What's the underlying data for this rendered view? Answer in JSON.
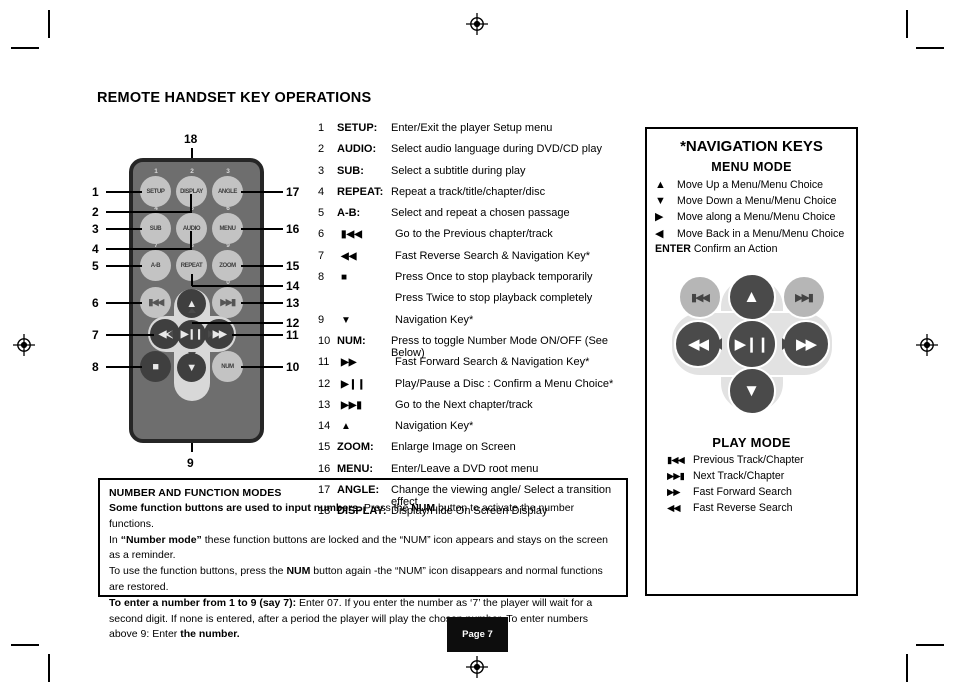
{
  "page_title": "REMOTE HANDSET KEY OPERATIONS",
  "footer": {
    "page_label": "Page 7"
  },
  "colors": {
    "remote_body": "#6e6e6e",
    "remote_border": "#262626",
    "button_light": "#c3c3c3",
    "button_dark": "#3f3f3f",
    "dpad_pad": "#e2e2e2",
    "ink": "#000000"
  },
  "remote": {
    "buttons": [
      {
        "label": "SETUP",
        "number": "1"
      },
      {
        "label": "DISPLAY",
        "number": "2"
      },
      {
        "label": "ANGLE",
        "number": "3"
      },
      {
        "label": "SUB",
        "number": "4"
      },
      {
        "label": "AUDIO",
        "number": "5"
      },
      {
        "label": "MENU",
        "number": "6"
      },
      {
        "label": "A-B",
        "number": "7"
      },
      {
        "label": "REPEAT",
        "number": "8"
      },
      {
        "label": "ZOOM",
        "number": "9"
      },
      {
        "label": "▮◀◀",
        "number": ""
      },
      {
        "label": "▶▶▮",
        "number": "0"
      },
      {
        "label": "NUM",
        "number": ""
      }
    ],
    "callouts_left": [
      "1",
      "2",
      "3",
      "4",
      "5",
      "6",
      "7",
      "8"
    ],
    "callouts_right": [
      "17",
      "16",
      "15",
      "14",
      "13",
      "12",
      "11",
      "10"
    ],
    "callout_top": "18",
    "callout_bottom": "9"
  },
  "key_list": [
    {
      "idx": "1",
      "name": "SETUP:",
      "desc": "Enter/Exit the player Setup menu",
      "glyph": false
    },
    {
      "idx": "2",
      "name": "AUDIO:",
      "desc": "Select audio language during DVD/CD play",
      "glyph": false
    },
    {
      "idx": "3",
      "name": "SUB:",
      "desc": "Select a subtitle during play",
      "glyph": false
    },
    {
      "idx": "4",
      "name": "REPEAT:",
      "desc": "Repeat a track/title/chapter/disc",
      "glyph": false
    },
    {
      "idx": "5",
      "name": "A-B:",
      "desc": "Select and repeat a chosen passage",
      "glyph": false
    },
    {
      "idx": "6",
      "name": "▮◀◀",
      "desc": "Go to the Previous chapter/track",
      "glyph": true
    },
    {
      "idx": "7",
      "name": "◀◀",
      "desc": "Fast Reverse Search & Navigation Key*",
      "glyph": true
    },
    {
      "idx": "8",
      "name": "■",
      "desc": "Press Once to stop playback temporarily",
      "glyph": true
    },
    {
      "idx": "",
      "name": "",
      "desc": "Press Twice to stop playback completely",
      "glyph": true
    },
    {
      "idx": "9",
      "name": "▼",
      "desc": "Navigation Key*",
      "glyph": true
    },
    {
      "idx": "10",
      "name": "NUM:",
      "desc": "Press to toggle Number Mode ON/OFF (See Below)",
      "glyph": false
    },
    {
      "idx": "11",
      "name": "▶▶",
      "desc": "Fast Forward Search & Navigation Key*",
      "glyph": true
    },
    {
      "idx": "12",
      "name": "▶❙❙",
      "desc": "Play/Pause a Disc : Confirm a Menu Choice*",
      "glyph": true
    },
    {
      "idx": "13",
      "name": "▶▶▮",
      "desc": "Go to the Next chapter/track",
      "glyph": true
    },
    {
      "idx": "14",
      "name": "▲",
      "desc": "Navigation Key*",
      "glyph": true
    },
    {
      "idx": "15",
      "name": "ZOOM:",
      "desc": "Enlarge Image on Screen",
      "glyph": false
    },
    {
      "idx": "16",
      "name": "MENU:",
      "desc": "Enter/Leave a DVD root menu",
      "glyph": false
    },
    {
      "idx": "17",
      "name": "ANGLE:",
      "desc": "Change the viewing angle/ Select a transition effect",
      "glyph": false
    },
    {
      "idx": "18",
      "name": "DISPLAY:",
      "desc": "Display/Hide On Screen Display",
      "glyph": false
    }
  ],
  "number_modes": {
    "heading": "NUMBER AND FUNCTION MODES",
    "line1_bold": "Some function buttons are used to input numbers.",
    "line1_rest_a": " Press the ",
    "line1_num": "NUM",
    "line1_rest_b": " button to activate the number functions.",
    "line2_a": "In ",
    "line2_bold": "“Number mode”",
    "line2_b": " these function buttons are locked and the “NUM” icon appears and stays on the screen as a reminder.",
    "line3_a": "To use the function buttons, press the ",
    "line3_num": "NUM",
    "line3_b": " button again -the “NUM” icon disappears and normal functions are restored.",
    "line4_bold": "To enter a number from 1 to 9 (say 7):",
    "line4_rest": " Enter 07. If you enter the number as ‘7’ the player will wait for a second digit. If none is entered, after a period the player will play the chosen number. To enter numbers above 9: Enter ",
    "line4_end_bold": "the number."
  },
  "nav_panel": {
    "title": "*NAVIGATION KEYS",
    "menu_mode_heading": "MENU MODE",
    "menu_mode_rows": [
      {
        "arrow": "▲",
        "text": "Move Up a Menu/Menu Choice"
      },
      {
        "arrow": "▼",
        "text": "Move Down a Menu/Menu Choice"
      },
      {
        "arrow": "▶",
        "text": "Move along a Menu/Menu Choice"
      },
      {
        "arrow": "◀",
        "text": "Move Back in a  Menu/Menu Choice"
      }
    ],
    "enter_label": "ENTER",
    "enter_text": " Confirm an Action",
    "dpad": {
      "prev_glyph": "▮◀◀",
      "next_glyph": "▶▶▮",
      "up_glyph": "▲",
      "down_glyph": "▼",
      "rew_glyph": "◀◀",
      "ffwd_glyph": "▶▶",
      "play_glyph": "▶❙❙"
    },
    "play_mode_heading": "PLAY MODE",
    "play_mode_rows": [
      {
        "glyph": "▮◀◀",
        "text": "Previous Track/Chapter"
      },
      {
        "glyph": "▶▶▮",
        "text": "Next Track/Chapter"
      },
      {
        "glyph": "▶▶",
        "text": "Fast Forward Search"
      },
      {
        "glyph": "◀◀",
        "text": "Fast Reverse Search"
      }
    ]
  }
}
